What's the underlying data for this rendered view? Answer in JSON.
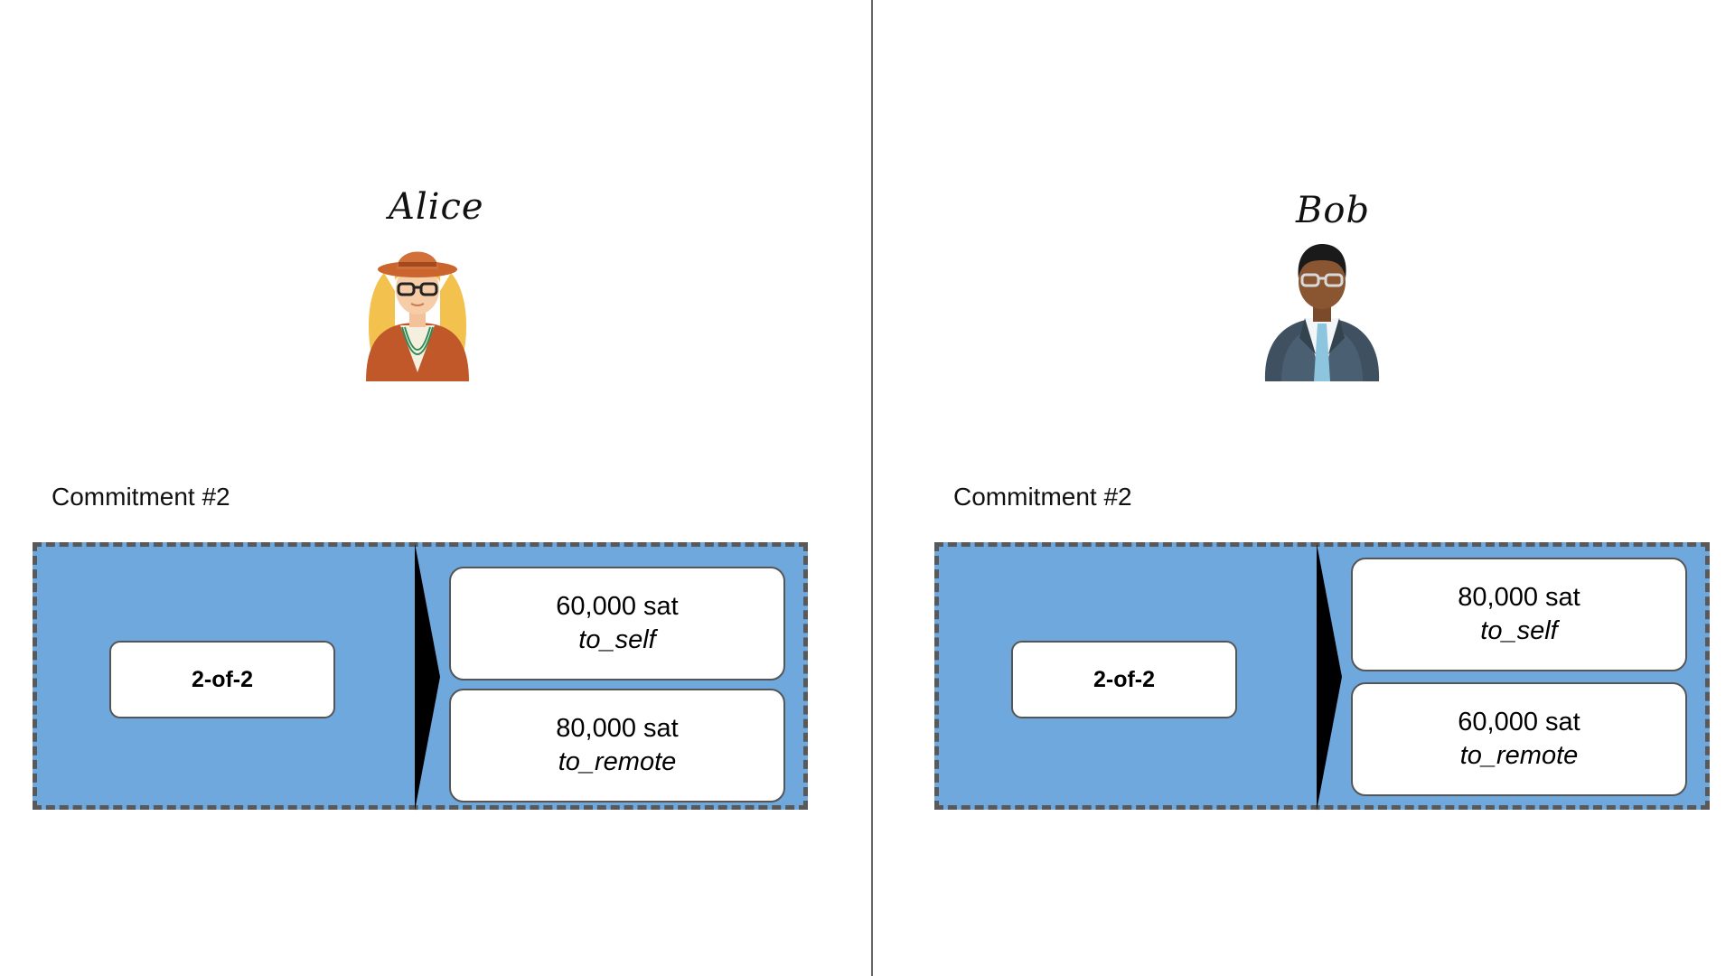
{
  "panels": [
    {
      "person": "Alice",
      "avatar_icon": "woman-avatar-icon",
      "commitment_title": "Commitment #2",
      "input_label": "2-of-2",
      "outputs": [
        {
          "amount": "60,000 sat",
          "label": "to_self"
        },
        {
          "amount": "80,000 sat",
          "label": "to_remote"
        }
      ]
    },
    {
      "person": "Bob",
      "avatar_icon": "man-avatar-icon",
      "commitment_title": "Commitment #2",
      "input_label": "2-of-2",
      "outputs": [
        {
          "amount": "80,000 sat",
          "label": "to_self"
        },
        {
          "amount": "60,000 sat",
          "label": "to_remote"
        }
      ]
    }
  ],
  "colors": {
    "transaction_fill": "#6fa8dc",
    "dashed_border": "#595959",
    "divider": "#666666"
  }
}
